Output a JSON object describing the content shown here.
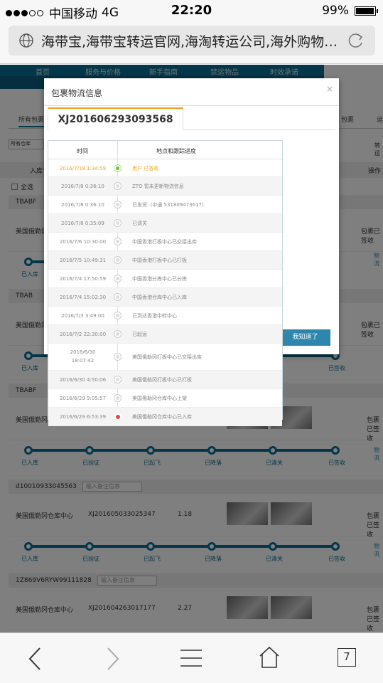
{
  "status_bar": {
    "carrier": "中国移动",
    "network": "4G",
    "time": "22:20",
    "battery": "99%"
  },
  "browser": {
    "url_title": "海带宝,海带宝转运官网,海淘转运公司,海外购物…",
    "tab_count": "7"
  },
  "site": {
    "nav": [
      "首页",
      "服务与价格",
      "新手指南",
      "禁运物品",
      "时效承诺"
    ],
    "tabs": {
      "all": "所有包裹",
      "c1": "包裹",
      "c2": "运"
    },
    "filter": "所有仓库",
    "header": {
      "inbound": "入库仓",
      "action": "操作"
    },
    "select_all": "全选",
    "side_btn": "转运"
  },
  "orders": [
    {
      "id": "TBABF",
      "warehouse": "美国俄勒冈仓",
      "status": "包裹已签收",
      "link": "物流"
    },
    {
      "id": "TBAB",
      "warehouse": "美国俄勒冈仓",
      "status": "包裹已签收",
      "link": ""
    },
    {
      "id": "TBABF",
      "warehouse": "美国俄勒冈仓",
      "status": "包裹已签收",
      "link": "物流"
    },
    {
      "id": "d10010933045563",
      "note_placeholder": "输入备注信息",
      "warehouse": "美国俄勒冈仓库中心",
      "order_no": "XJ201605033025347",
      "weight": "1.18",
      "status": "包裹已签收",
      "link": "物流"
    },
    {
      "id": "1Z869V6RYW99111828",
      "note_placeholder": "输入备注信息",
      "warehouse": "美国俄勒冈仓库中心",
      "order_no": "XJ201604263017177",
      "weight": "2.27",
      "status": "包裹已签收"
    }
  ],
  "progress_labels": [
    "已入库",
    "已验证",
    "已起飞",
    "已降落",
    "已清关",
    "已签收"
  ],
  "modal": {
    "title": "包裹物流信息",
    "close": "×",
    "tracking_no": "XJ201606293093568",
    "ack_button": "我知道了",
    "columns": {
      "time": "时间",
      "location": "地点和跟踪进度"
    },
    "events": [
      {
        "time": "2016/7/18 1:34:59",
        "desc": "用户 已签收"
      },
      {
        "time": "2016/7/8 0:36:10",
        "desc": "ZTO 暂未更新物流信息"
      },
      {
        "time": "2016/7/8 0:36:10",
        "desc": "已发货: (中通 531809473617)"
      },
      {
        "time": "2016/7/8 0:35:09",
        "desc": "已清关"
      },
      {
        "time": "2016/7/6 10:30:00",
        "desc": "中国香港打板中心已交接出库"
      },
      {
        "time": "2016/7/5 10:49:31",
        "desc": "中国香港打板中心已打板"
      },
      {
        "time": "2016/7/4 17:50:59",
        "desc": "中国香港分拣中心已分拣"
      },
      {
        "time": "2016/7/4 15:02:30",
        "desc": "中国香港仓库中心已入库"
      },
      {
        "time": "2016/7/3 3:49:00",
        "desc": "已到达香港中转中心"
      },
      {
        "time": "2016/7/2 22:30:00",
        "desc": "已起运"
      },
      {
        "time": "2016/6/30 18:07:42",
        "desc": "美国俄勒冈打板中心已交接出库"
      },
      {
        "time": "2016/6/30 4:50:06",
        "desc": "美国俄勒冈打板中心已打板"
      },
      {
        "time": "2016/6/29 9:05:57",
        "desc": "美国俄勒冈仓库中心上架"
      },
      {
        "time": "2016/6/29 6:53:39",
        "desc": "美国俄勒冈仓库中心已入库"
      }
    ]
  }
}
